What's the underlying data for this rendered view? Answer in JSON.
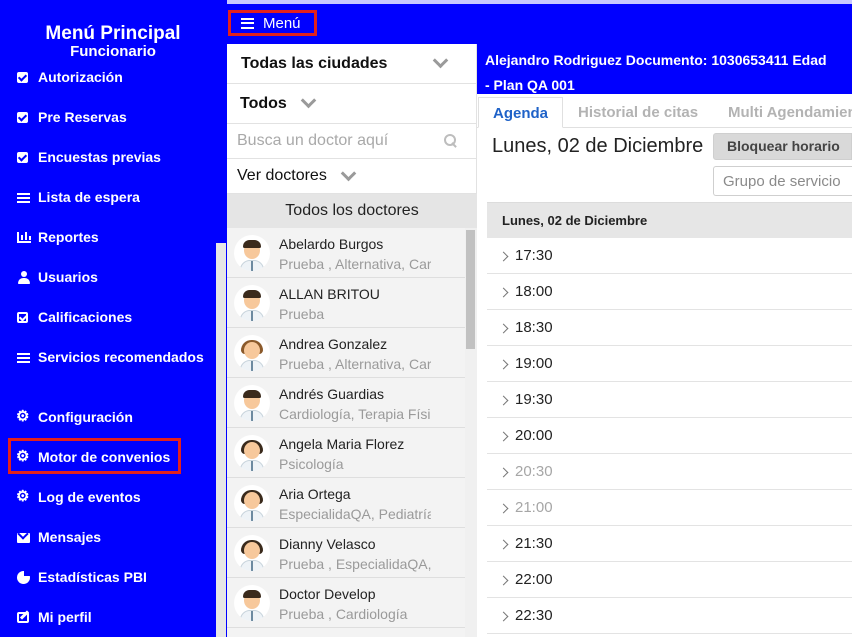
{
  "header": {
    "menu_label": "Menú"
  },
  "sidebar": {
    "title": "Menú Principal",
    "subtitle": "Funcionario",
    "items": [
      {
        "label": "Autorización",
        "icon": "check-square-icon"
      },
      {
        "label": "Pre Reservas",
        "icon": "check-square-icon"
      },
      {
        "label": "Encuestas previas",
        "icon": "check-square-icon"
      },
      {
        "label": "Lista de espera",
        "icon": "list-icon"
      },
      {
        "label": "Reportes",
        "icon": "bar-chart-icon"
      },
      {
        "label": "Usuarios",
        "icon": "user-icon"
      },
      {
        "label": "Calificaciones",
        "icon": "check-square-outline-icon"
      },
      {
        "label": "Servicios recomendados",
        "icon": "list-icon"
      },
      {
        "label": "Configuración",
        "icon": "gear-icon"
      },
      {
        "label": "Motor de convenios",
        "icon": "gear-icon",
        "highlighted": true
      },
      {
        "label": "Log de eventos",
        "icon": "gear-icon"
      },
      {
        "label": "Mensajes",
        "icon": "envelope-icon"
      },
      {
        "label": "Estadísticas PBI",
        "icon": "pie-chart-icon"
      },
      {
        "label": "Mi perfil",
        "icon": "edit-icon"
      }
    ]
  },
  "doctors_panel": {
    "city_filter": "Todas las ciudades",
    "specialty_filter": "Todos",
    "search_placeholder": "Busca un doctor aquí",
    "view_filter": "Ver doctores",
    "list_header": "Todos los doctores",
    "doctors": [
      {
        "name": "Abelardo Burgos",
        "specialties": "Prueba , Alternativa, Cardiología",
        "avatar": "male-doctor"
      },
      {
        "name": "ALLAN BRITOU",
        "specialties": "Prueba",
        "avatar": "male-doctor"
      },
      {
        "name": "Andrea Gonzalez",
        "specialties": "Prueba , Alternativa, Cardiología",
        "avatar": "female-doctor"
      },
      {
        "name": "Andrés Guardias",
        "specialties": "Cardiología, Terapia Física",
        "avatar": "male-doctor"
      },
      {
        "name": "Angela Maria Florez",
        "specialties": "Psicología",
        "avatar": "female-doctor"
      },
      {
        "name": "Aria Ortega",
        "specialties": "EspecialidaQA, Pediatría",
        "avatar": "female-doctor"
      },
      {
        "name": "Dianny Velasco",
        "specialties": "Prueba , EspecialidaQA, Pediatría",
        "avatar": "female-doctor"
      },
      {
        "name": "Doctor Develop",
        "specialties": "Prueba , Cardiología",
        "avatar": "male-doctor"
      }
    ]
  },
  "main": {
    "patient_line1": "Alejandro Rodriguez  Documento: 1030653411  Edad",
    "patient_line2": "- Plan QA 001",
    "tabs": [
      {
        "label": "Agenda",
        "active": true
      },
      {
        "label": "Historial de citas",
        "active": false
      },
      {
        "label": "Multi Agendamiento",
        "active": false
      }
    ],
    "date_title": "Lunes, 02 de Diciembre",
    "block_button": "Bloquear horario",
    "group_placeholder": "Grupo de servicio",
    "day_header": "Lunes, 02 de Diciembre",
    "slots": [
      {
        "time": "17:30",
        "muted": false
      },
      {
        "time": "18:00",
        "muted": false
      },
      {
        "time": "18:30",
        "muted": false
      },
      {
        "time": "19:00",
        "muted": false
      },
      {
        "time": "19:30",
        "muted": false
      },
      {
        "time": "20:00",
        "muted": false
      },
      {
        "time": "20:30",
        "muted": true
      },
      {
        "time": "21:00",
        "muted": true
      },
      {
        "time": "21:30",
        "muted": false
      },
      {
        "time": "22:00",
        "muted": false
      },
      {
        "time": "22:30",
        "muted": false
      }
    ]
  },
  "colors": {
    "primary_blue": "#0000ff",
    "highlight_red": "#e2211c",
    "active_tab_blue": "#1f62c8"
  }
}
